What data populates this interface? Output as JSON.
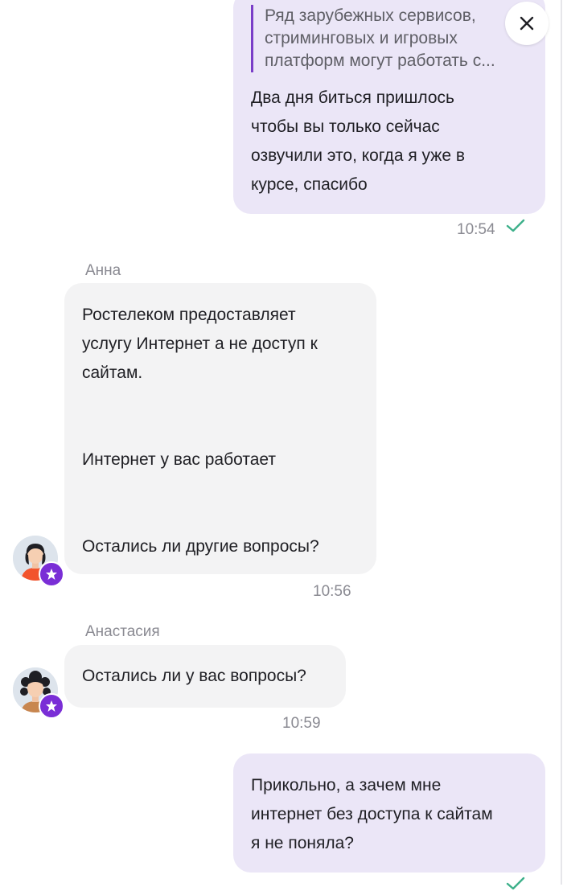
{
  "messages": {
    "m1": {
      "quote": "Ряд зарубежных сервисов,\nстриминговых и игровых\nплатформ могут работать с...",
      "text": "Два дня биться пришлось\nчтобы вы только сейчас\nозвучили это, когда я уже в\nкурсе, спасибо",
      "time": "10:54"
    },
    "m2": {
      "sender": "Анна",
      "text": "Ростелеком предоставляет\nуслугу Интернет а не доступ к\nсайтам.\n\n\nИнтернет у вас работает\n\n\nОстались ли другие вопросы?",
      "time": "10:56"
    },
    "m3": {
      "sender": "Анастасия",
      "text": "Остались ли у вас вопросы?",
      "time": "10:59"
    },
    "m4": {
      "text": "Прикольно, а зачем мне\nинтернет без доступа к сайтам\nя не поняла?"
    }
  },
  "icons": {
    "close": "close-icon",
    "read_receipt": "check-icon",
    "operator_badge": "star-icon"
  },
  "colors": {
    "outgoing_bubble": "#ebe6f7",
    "incoming_bubble": "#f3f3f4",
    "accent": "#7a2ed6",
    "check": "#3db08a"
  }
}
